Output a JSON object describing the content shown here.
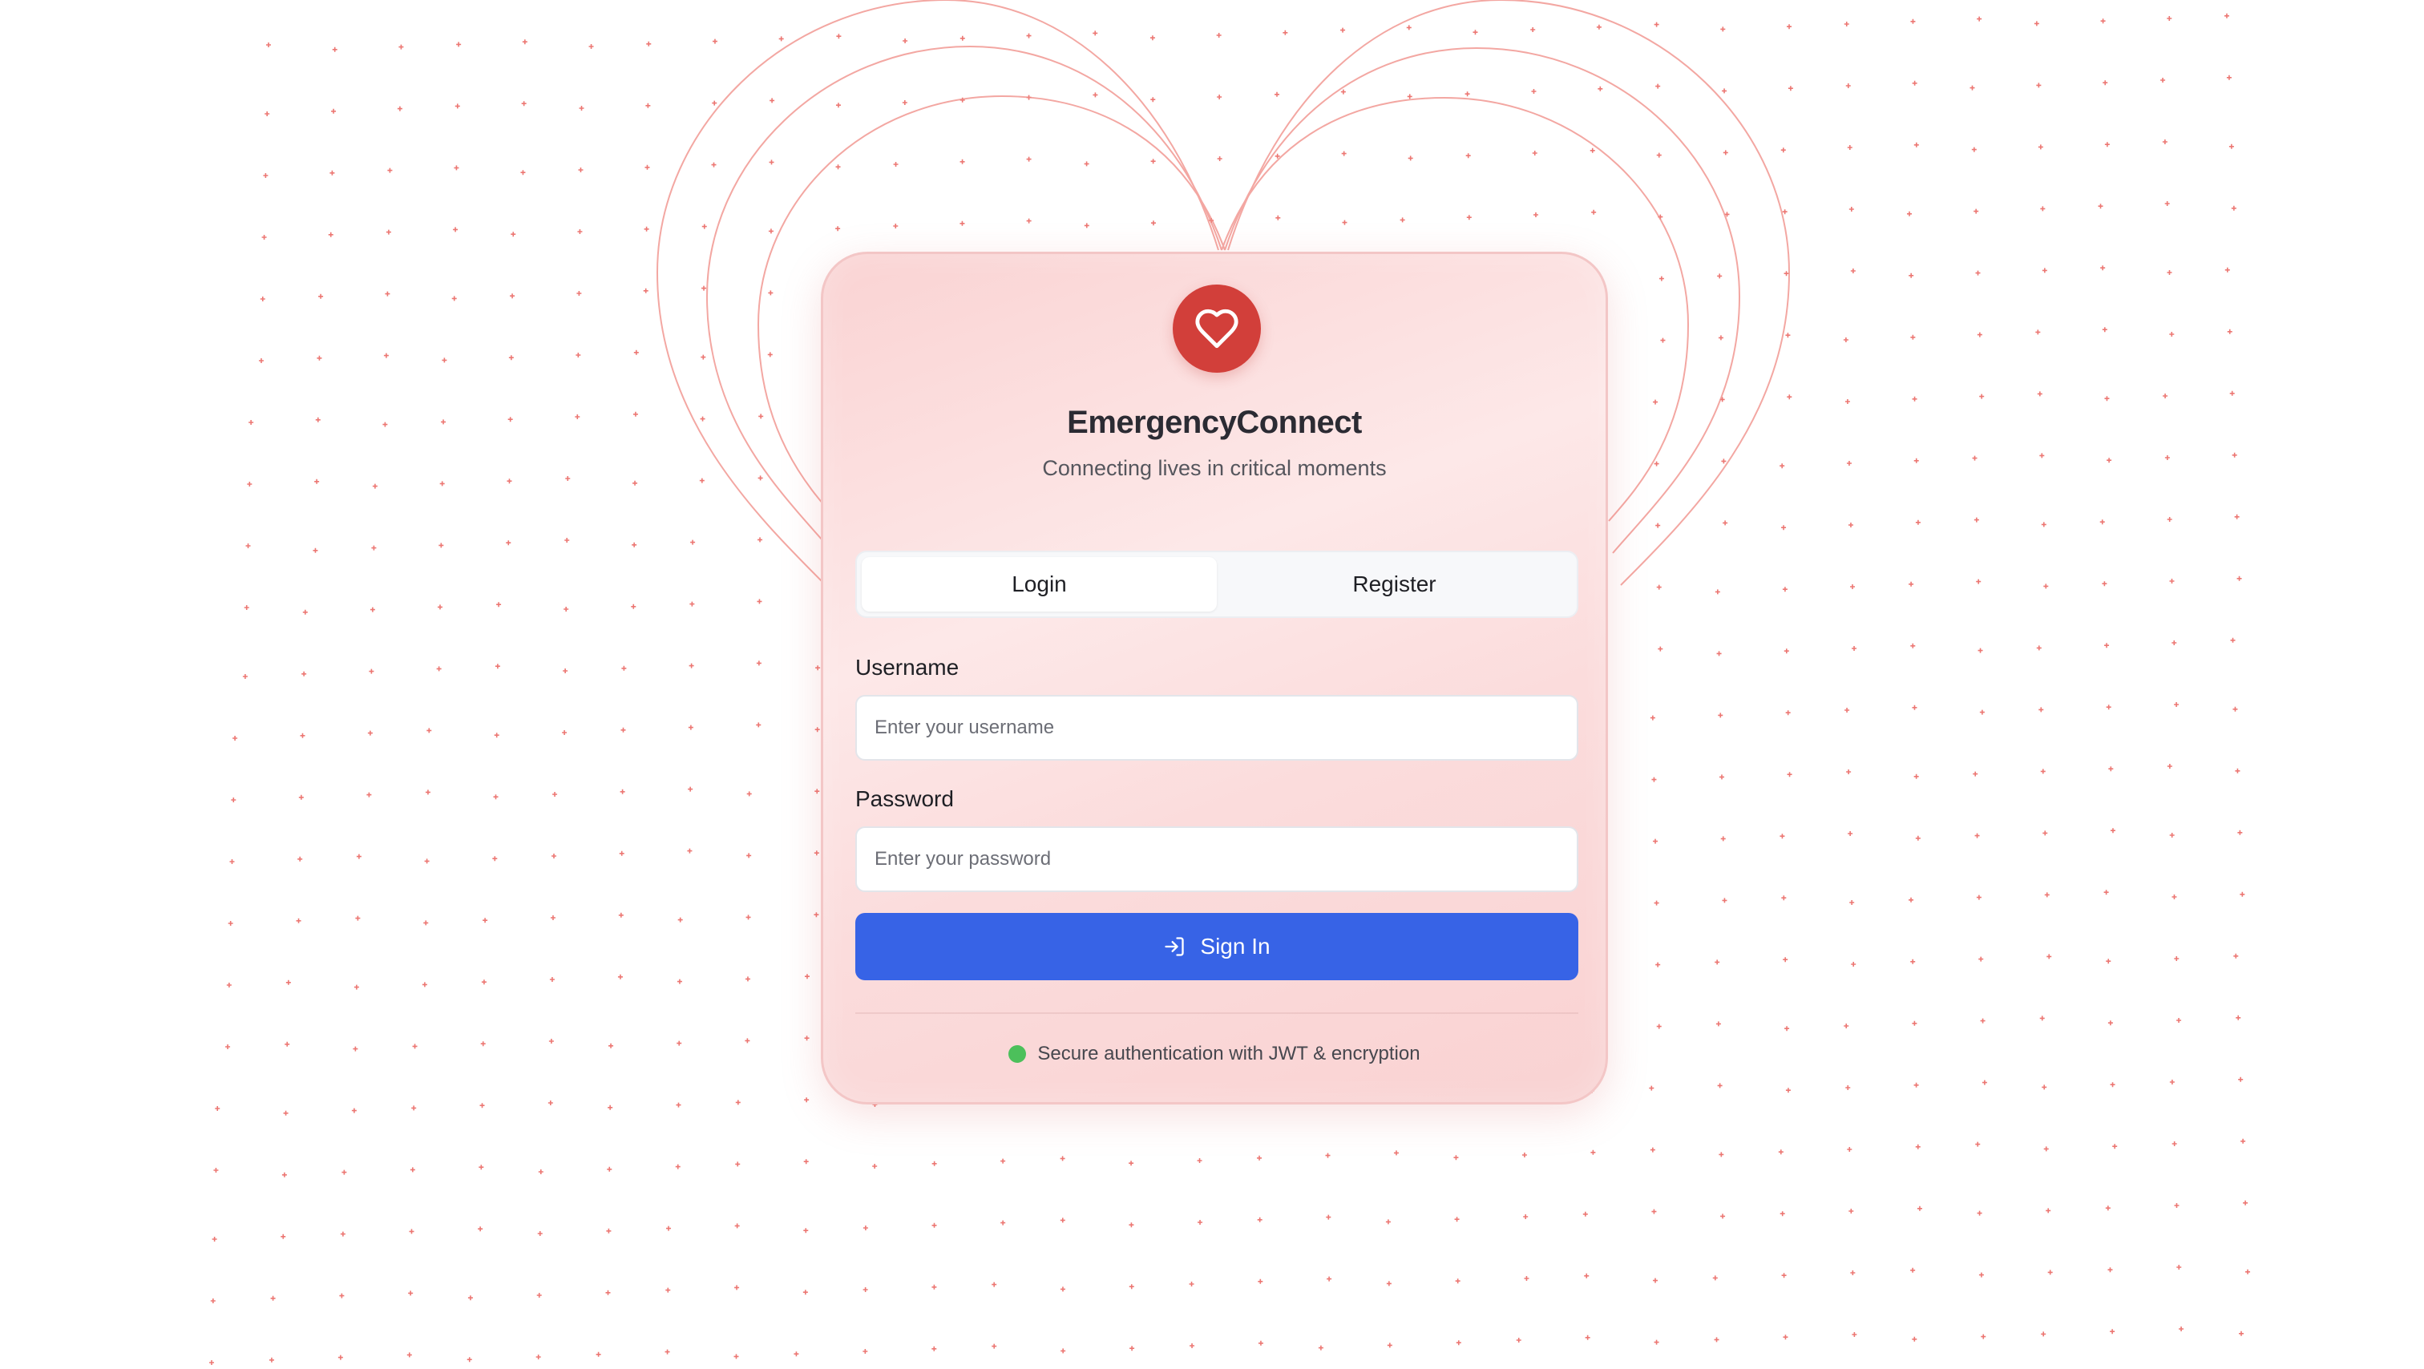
{
  "app": {
    "title": "EmergencyConnect",
    "subtitle": "Connecting lives in critical moments",
    "logo_icon": "heart-icon"
  },
  "tabs": [
    {
      "label": "Login",
      "active": true
    },
    {
      "label": "Register",
      "active": false
    }
  ],
  "form": {
    "username_label": "Username",
    "username_placeholder": "Enter your username",
    "username_value": "",
    "password_label": "Password",
    "password_placeholder": "Enter your password",
    "password_value": "",
    "submit_label": "Sign In",
    "submit_icon": "log-in-icon"
  },
  "footer": {
    "security_text": "Secure authentication with JWT & encryption",
    "status_color": "#4cc05b"
  },
  "colors": {
    "accent": "#3763e6",
    "brand": "#d23f3a",
    "background_pattern": "#e8554f"
  }
}
